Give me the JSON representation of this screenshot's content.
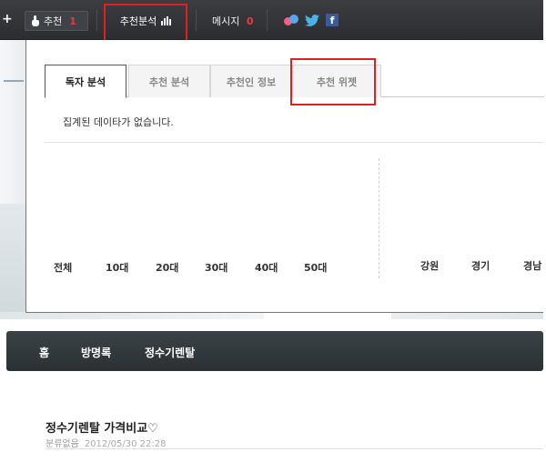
{
  "topbar": {
    "recommend_label": "추천",
    "recommend_count": "1",
    "analysis_label": "추천분석",
    "message_label": "메시지",
    "message_count": "0",
    "share_icons": [
      "me2day-icon",
      "twitter-icon",
      "facebook-icon"
    ],
    "facebook_glyph": "f",
    "twitter_glyph": "🐦"
  },
  "panel": {
    "tabs": [
      {
        "label": "독자 분석",
        "active": true
      },
      {
        "label": "추천 분석",
        "active": false
      },
      {
        "label": "추천인 정보",
        "active": false
      },
      {
        "label": "추천 위젯",
        "active": false
      }
    ],
    "no_data_text": "집계된 데이타가 없습니다.",
    "age_groups": [
      "전체",
      "10대",
      "20대",
      "30대",
      "40대",
      "50대"
    ],
    "regions": [
      "강원",
      "경기",
      "경남"
    ]
  },
  "nav": {
    "items": [
      "홈",
      "방명록",
      "정수기렌탈"
    ]
  },
  "post": {
    "title": "정수기렌탈 가격비교♡",
    "category": "분류없음",
    "date": "2012/05/30 22:28"
  },
  "colors": {
    "highlight_red": "#e02020",
    "count_red": "#e83b3b",
    "topbar_bg": "#2b2d30",
    "nav_bg": "#2a3033"
  }
}
